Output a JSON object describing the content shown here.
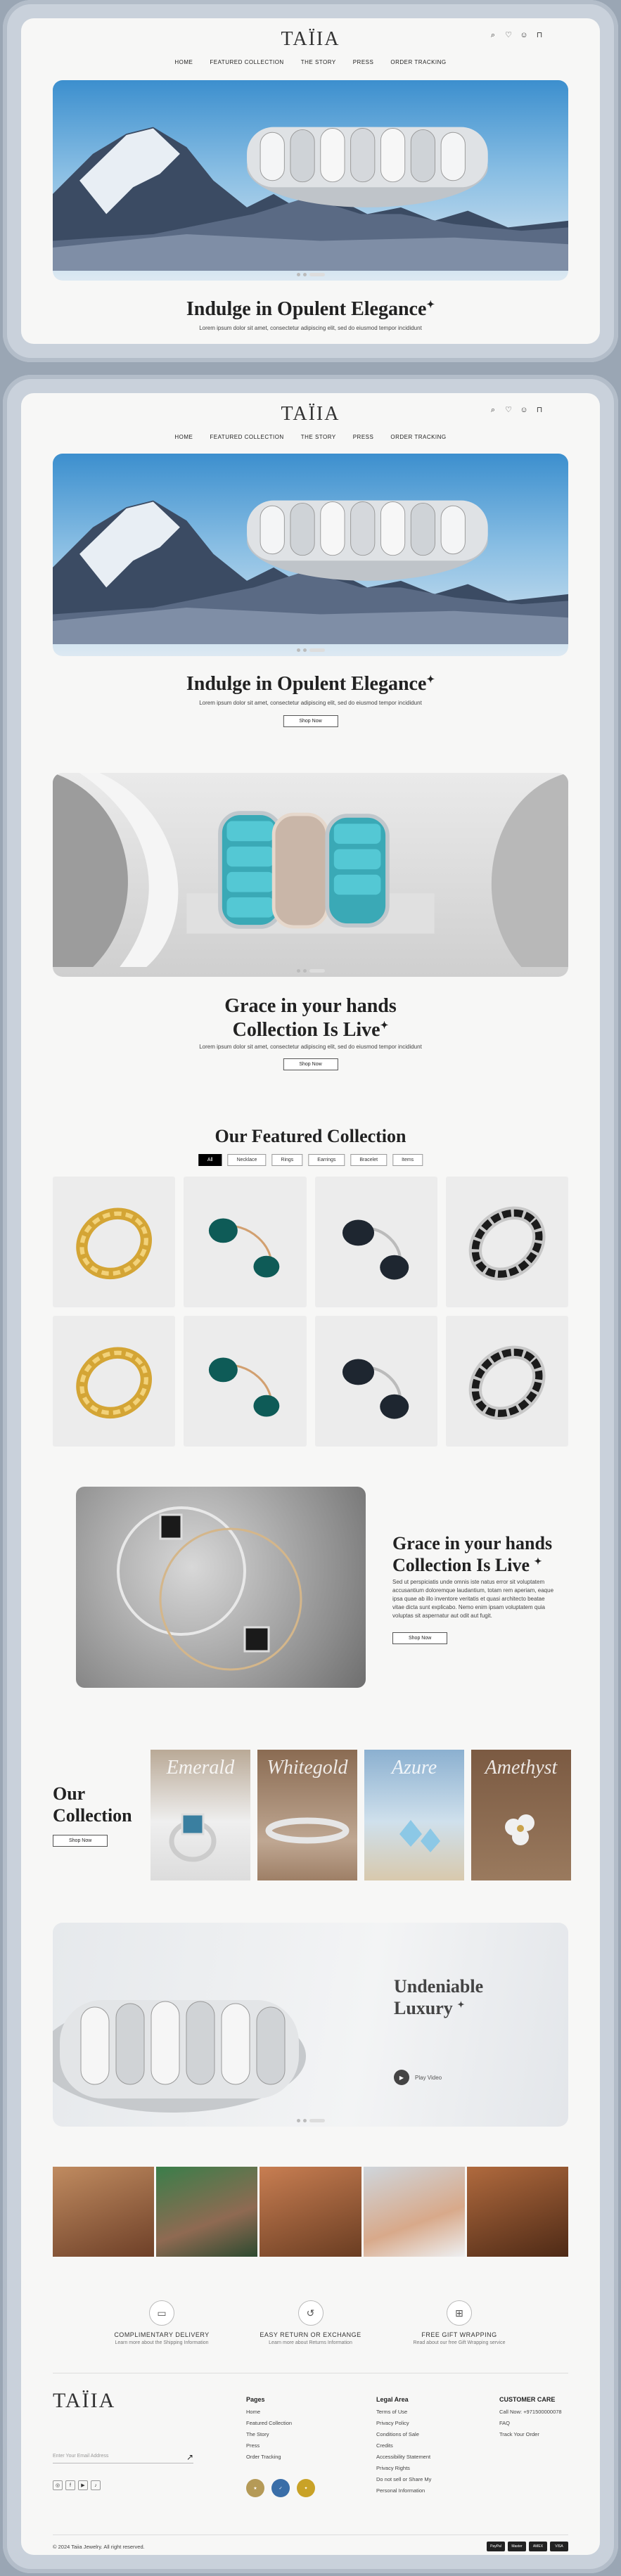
{
  "brand": {
    "logo": "TAÏIA"
  },
  "nav": [
    "HOME",
    "FEATURED COLLECTION",
    "THE STORY",
    "PRESS",
    "ORDER TRACKING"
  ],
  "header_icons": [
    "search-icon",
    "heart-icon",
    "user-icon",
    "bag-icon"
  ],
  "hero": {
    "title": "Indulge in Opulent Elegance",
    "sparkle": "✦",
    "subtitle": "Lorem ipsum dolor sit amet, consectetur adipiscing elit, sed do eiusmod tempor incididunt",
    "button": "Shop Now"
  },
  "hero2": {
    "title_line1": "Grace in your hands",
    "title_line2": "Collection Is Live",
    "sparkle": "✦",
    "subtitle": "Lorem ipsum dolor sit amet, consectetur adipiscing elit, sed do eiusmod tempor incididunt",
    "button": "Shop Now"
  },
  "featured": {
    "title": "Our Featured Collection",
    "tabs": [
      "All",
      "Necklace",
      "Rings",
      "Earrings",
      "Bracelet",
      "Items"
    ],
    "active_tab": "All"
  },
  "promo": {
    "title_line1": "Grace in your hands",
    "title_line2": "Collection Is Live",
    "sparkle": "✦",
    "text": "Sed ut perspiciatis unde omnis iste natus error sit voluptatem accusantium doloremque laudantium, totam rem aperiam, eaque ipsa quae ab illo inventore veritatis et quasi architecto beatae vitae dicta sunt explicabo. Nemo enim ipsam voluptatem quia voluptas sit aspernatur aut odit aut fugit.",
    "button": "Shop Now"
  },
  "our_collection": {
    "title_line1": "Our",
    "title_line2": "Collection",
    "button": "Shop Now",
    "items": [
      "Emerald",
      "Whitegold",
      "Azure",
      "Amethyst"
    ]
  },
  "undeniable": {
    "title_line1": "Undeniable",
    "title_line2": "Luxury",
    "sparkle": "✦",
    "play": "Play Video"
  },
  "services": [
    {
      "icon": "truck-icon",
      "title": "COMPLIMENTARY DELIVERY",
      "text": "Learn more about the Shipping Information"
    },
    {
      "icon": "return-icon",
      "title": "EASY RETURN OR EXCHANGE",
      "text": "Learn more about Returns Information"
    },
    {
      "icon": "gift-icon",
      "title": "FREE GIFT WRAPPING",
      "text": "Read about our free Gift Wrapping service"
    }
  ],
  "footer": {
    "logo": "TAÏIA",
    "email_placeholder": "Enter Your Email Address",
    "pages_title": "Pages",
    "pages": [
      "Home",
      "Featured Collection",
      "The Story",
      "Press",
      "Order Tracking"
    ],
    "legal_title": "Legal Area",
    "legal": [
      "Terms of Use",
      "Privacy Policy",
      "Conditions of Sale",
      "Credits",
      "Accessibility Statement",
      "Privacy Rights",
      "Do not sell or Share My",
      "Personal Information"
    ],
    "care_title": "CUSTOMER CARE",
    "care": [
      "Call Now: +971500000078",
      "FAQ",
      "Track Your Order"
    ],
    "copyright": "© 2024 Taiia Jewelry. All right reserved.",
    "payments": [
      "PayPal",
      "Master",
      "AMEX",
      "VISA"
    ]
  }
}
